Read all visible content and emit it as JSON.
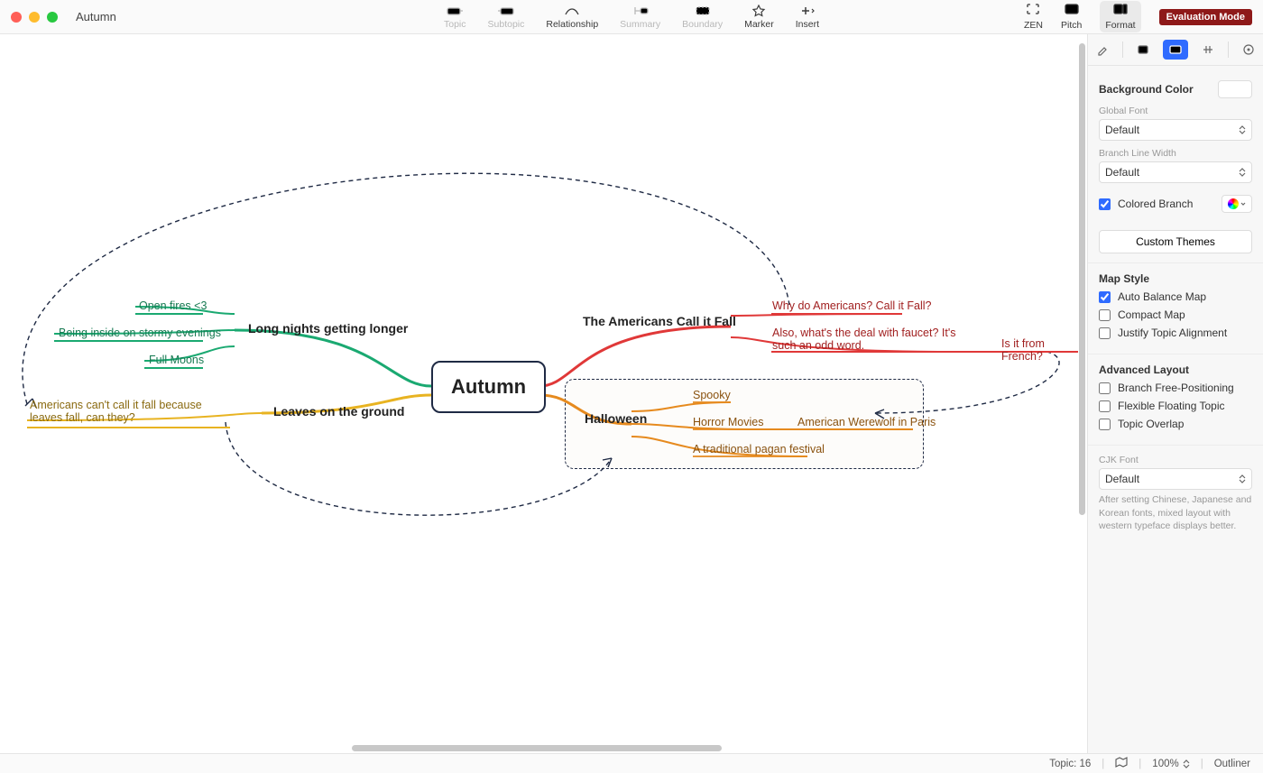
{
  "window": {
    "title": "Autumn"
  },
  "toolbar": {
    "items": [
      {
        "name": "topic",
        "label": "Topic",
        "disabled": true
      },
      {
        "name": "subtopic",
        "label": "Subtopic",
        "disabled": true
      },
      {
        "name": "relationship",
        "label": "Relationship",
        "disabled": false
      },
      {
        "name": "summary",
        "label": "Summary",
        "disabled": true
      },
      {
        "name": "boundary",
        "label": "Boundary",
        "disabled": true
      },
      {
        "name": "marker",
        "label": "Marker",
        "disabled": false
      },
      {
        "name": "insert",
        "label": "Insert",
        "disabled": false
      }
    ],
    "right": [
      {
        "name": "zen",
        "label": "ZEN"
      },
      {
        "name": "pitch",
        "label": "Pitch"
      },
      {
        "name": "format",
        "label": "Format",
        "active": true
      }
    ],
    "badge": "Evaluation Mode"
  },
  "mindmap": {
    "central": "Autumn",
    "branches": {
      "left": [
        {
          "label": "Long nights getting longer",
          "color": "#1aa971",
          "children": [
            {
              "text": "Open fires <3"
            },
            {
              "text": "Being inside on stormy evenings"
            },
            {
              "text": "Full Moons"
            }
          ]
        },
        {
          "label": "Leaves on the ground",
          "color": "#e8b321",
          "children": [
            {
              "text": "Americans can't call it fall because leaves fall, can they?"
            }
          ]
        }
      ],
      "right": [
        {
          "label": "The Americans Call it Fall",
          "color": "#e03838",
          "children": [
            {
              "text": "Why do Americans? Call it Fall?"
            },
            {
              "text": "Also, what's the deal with faucet? It's such an odd word.",
              "children": [
                {
                  "text": "Is it from French?"
                }
              ]
            }
          ]
        },
        {
          "label": "Halloween",
          "color": "#e68a1e",
          "children": [
            {
              "text": "Spooky"
            },
            {
              "text": "Horror Movies",
              "children": [
                {
                  "text": "American Werewolf in Paris"
                }
              ]
            },
            {
              "text": "A traditional pagan festival"
            }
          ]
        }
      ]
    }
  },
  "sidebar": {
    "background_color_label": "Background Color",
    "global_font_label": "Global Font",
    "global_font_value": "Default",
    "branch_line_width_label": "Branch Line Width",
    "branch_line_width_value": "Default",
    "colored_branch_label": "Colored Branch",
    "colored_branch_checked": true,
    "custom_themes_btn": "Custom Themes",
    "map_style_heading": "Map Style",
    "auto_balance_label": "Auto Balance Map",
    "auto_balance_checked": true,
    "compact_map_label": "Compact Map",
    "compact_map_checked": false,
    "justify_topic_label": "Justify Topic Alignment",
    "justify_topic_checked": false,
    "advanced_layout_heading": "Advanced Layout",
    "branch_free_label": "Branch Free-Positioning",
    "branch_free_checked": false,
    "flexible_floating_label": "Flexible Floating Topic",
    "flexible_floating_checked": false,
    "topic_overlap_label": "Topic Overlap",
    "topic_overlap_checked": false,
    "cjk_font_label": "CJK Font",
    "cjk_font_value": "Default",
    "cjk_help": "After setting Chinese, Japanese and Korean fonts, mixed layout with western typeface displays better."
  },
  "status": {
    "topic_count_label": "Topic:",
    "topic_count": 16,
    "zoom": "100%",
    "outliner": "Outliner"
  }
}
